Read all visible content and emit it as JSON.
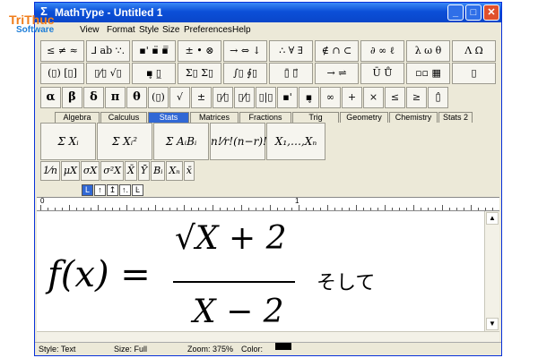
{
  "window": {
    "title": "MathType - Untitled 1",
    "min_glyph": "_",
    "max_glyph": "□",
    "close_glyph": "✕"
  },
  "logo": {
    "line1": "TriThuc",
    "line2": "Software"
  },
  "menu": [
    "View",
    "Format",
    "Style",
    "Size",
    "Preferences",
    "Help"
  ],
  "palette_row1": [
    "≤ ≠ ≈",
    "⅃ ab ∵.",
    "▪' ▪̈ ▪̿",
    "± • ⊗",
    "→ ⇔ ↓",
    "∴ ∀ ∃",
    "∉ ∩ ⊂",
    "∂ ∞ ℓ",
    "λ ω θ",
    "Λ Ω"
  ],
  "palette_row2": [
    "(▯) [▯]",
    "▯⁄▯ √▯",
    "▪̥ ▯̲",
    "Σ▯ Σ▯",
    "∫▯ ∮▯",
    "▯̄ ▯⃗",
    "→ ⇌",
    "Ū Ů",
    "▫▫ ▦",
    "▯"
  ],
  "symbols": [
    "α",
    "β",
    "δ",
    "π",
    "θ",
    "(▯)",
    "√",
    "±",
    "▯⁄▯",
    "▯⁄▯",
    "▯|▯",
    "▪'",
    "▪̥",
    "∞",
    "+",
    "×",
    "≤",
    "≥",
    "▯̂"
  ],
  "tabs": [
    {
      "label": "Algebra",
      "active": false
    },
    {
      "label": "Calculus",
      "active": false
    },
    {
      "label": "Stats",
      "active": true
    },
    {
      "label": "Matrices",
      "active": false
    },
    {
      "label": "Fractions",
      "active": false
    },
    {
      "label": "Trig",
      "active": false
    },
    {
      "label": "Geometry",
      "active": false
    },
    {
      "label": "Chemistry",
      "active": false
    },
    {
      "label": "Stats 2",
      "active": false
    }
  ],
  "templates": [
    "Σ Xᵢ",
    "Σ Xᵢ²",
    "Σ AᵢBᵢ",
    "n!⁄r!(n−r)!",
    "X₁,…,Xₙ"
  ],
  "small_templates": [
    "1⁄n",
    "μX",
    "σX",
    "σ²X",
    "X̄",
    "Ȳ",
    "Bᵢ",
    "Xₙ",
    "x̄"
  ],
  "tabstops": [
    "L",
    "↑",
    "↥",
    "↑.",
    "Ŀ"
  ],
  "ruler": {
    "start": "0",
    "mark": "1"
  },
  "equation": {
    "lhs": "f(x) =",
    "numerator": "√X + 2",
    "denominator": "X − 2",
    "suffix": "そして"
  },
  "status": {
    "style": "Style: Text",
    "size": "Size: Full",
    "zoom": "Zoom: 375%",
    "color": "Color:"
  }
}
